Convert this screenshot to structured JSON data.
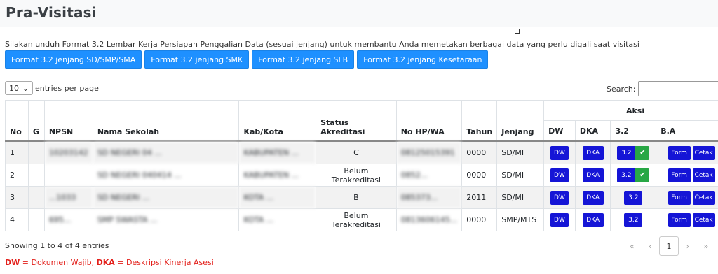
{
  "page_title": "Pra-Visitasi",
  "intro_text": "Silakan unduh Format 3.2 Lembar Kerja Persiapan Penggalian Data (sesuai jenjang) untuk membantu Anda memetakan berbagai data yang perlu digali saat visitasi",
  "format_buttons": [
    "Format 3.2 jenjang SD/SMP/SMA",
    "Format 3.2 jenjang SMK",
    "Format 3.2 jenjang SLB",
    "Format 3.2 jenjang Kesetaraan"
  ],
  "length": {
    "value": "10",
    "suffix": "entries per page"
  },
  "search": {
    "label": "Search:",
    "value": ""
  },
  "table": {
    "headers": {
      "no": "No",
      "g": "G",
      "npsn": "NPSN",
      "nama": "Nama Sekolah",
      "kab": "Kab/Kota",
      "status": "Status Akreditasi",
      "hp": "No HP/WA",
      "tahun": "Tahun",
      "jenjang": "Jenjang",
      "aksi": "Aksi",
      "dw": "DW",
      "dka": "DKA",
      "f32": "3.2",
      "ba": "B.A"
    },
    "rows": [
      {
        "no": "1",
        "g": "",
        "npsn": "10203142",
        "nama": "SD NEGERI 04 ...",
        "kab": "KABUPATEN ...",
        "status": "C",
        "hp": "08125015391",
        "tahun": "0000",
        "jenjang": "SD/MI",
        "checked": true
      },
      {
        "no": "2",
        "g": "",
        "npsn": "",
        "nama": "SD NEGERI 040414 ...",
        "kab": "KABUPATEN ...",
        "status": "Belum Terakreditasi",
        "hp": "0852...",
        "tahun": "0000",
        "jenjang": "SD/MI",
        "checked": true
      },
      {
        "no": "3",
        "g": "",
        "npsn": "...1033",
        "nama": "SD NEGERI ...",
        "kab": "KOTA ...",
        "status": "B",
        "hp": "085373...",
        "tahun": "2011",
        "jenjang": "SD/MI",
        "checked": false
      },
      {
        "no": "4",
        "g": "",
        "npsn": "695...",
        "nama": "SMP SWASTA ...",
        "kab": "KOTA ...",
        "status": "Belum Terakreditasi",
        "hp": "0813606145...",
        "tahun": "0000",
        "jenjang": "SMP/MTS",
        "checked": false
      }
    ],
    "btn": {
      "dw": "DW",
      "dka": "DKA",
      "f32": "3.2",
      "form": "Form",
      "cetak": "Cetak",
      "check": "✔"
    }
  },
  "info_text": "Showing 1 to 4 of 4 entries",
  "pagination": {
    "first": "«",
    "prev": "‹",
    "page": "1",
    "next": "›",
    "last": "»"
  },
  "legend": {
    "dw": "DW",
    "dw_text": " = Dokumen Wajib, ",
    "dka": "DKA",
    "dka_text": " = Deskripsi Kinerja Asesi"
  },
  "colors": {
    "primary_button": "#1e90ff",
    "action_button": "#1515d6",
    "check": "#28a745",
    "legend": "#e3201b"
  }
}
